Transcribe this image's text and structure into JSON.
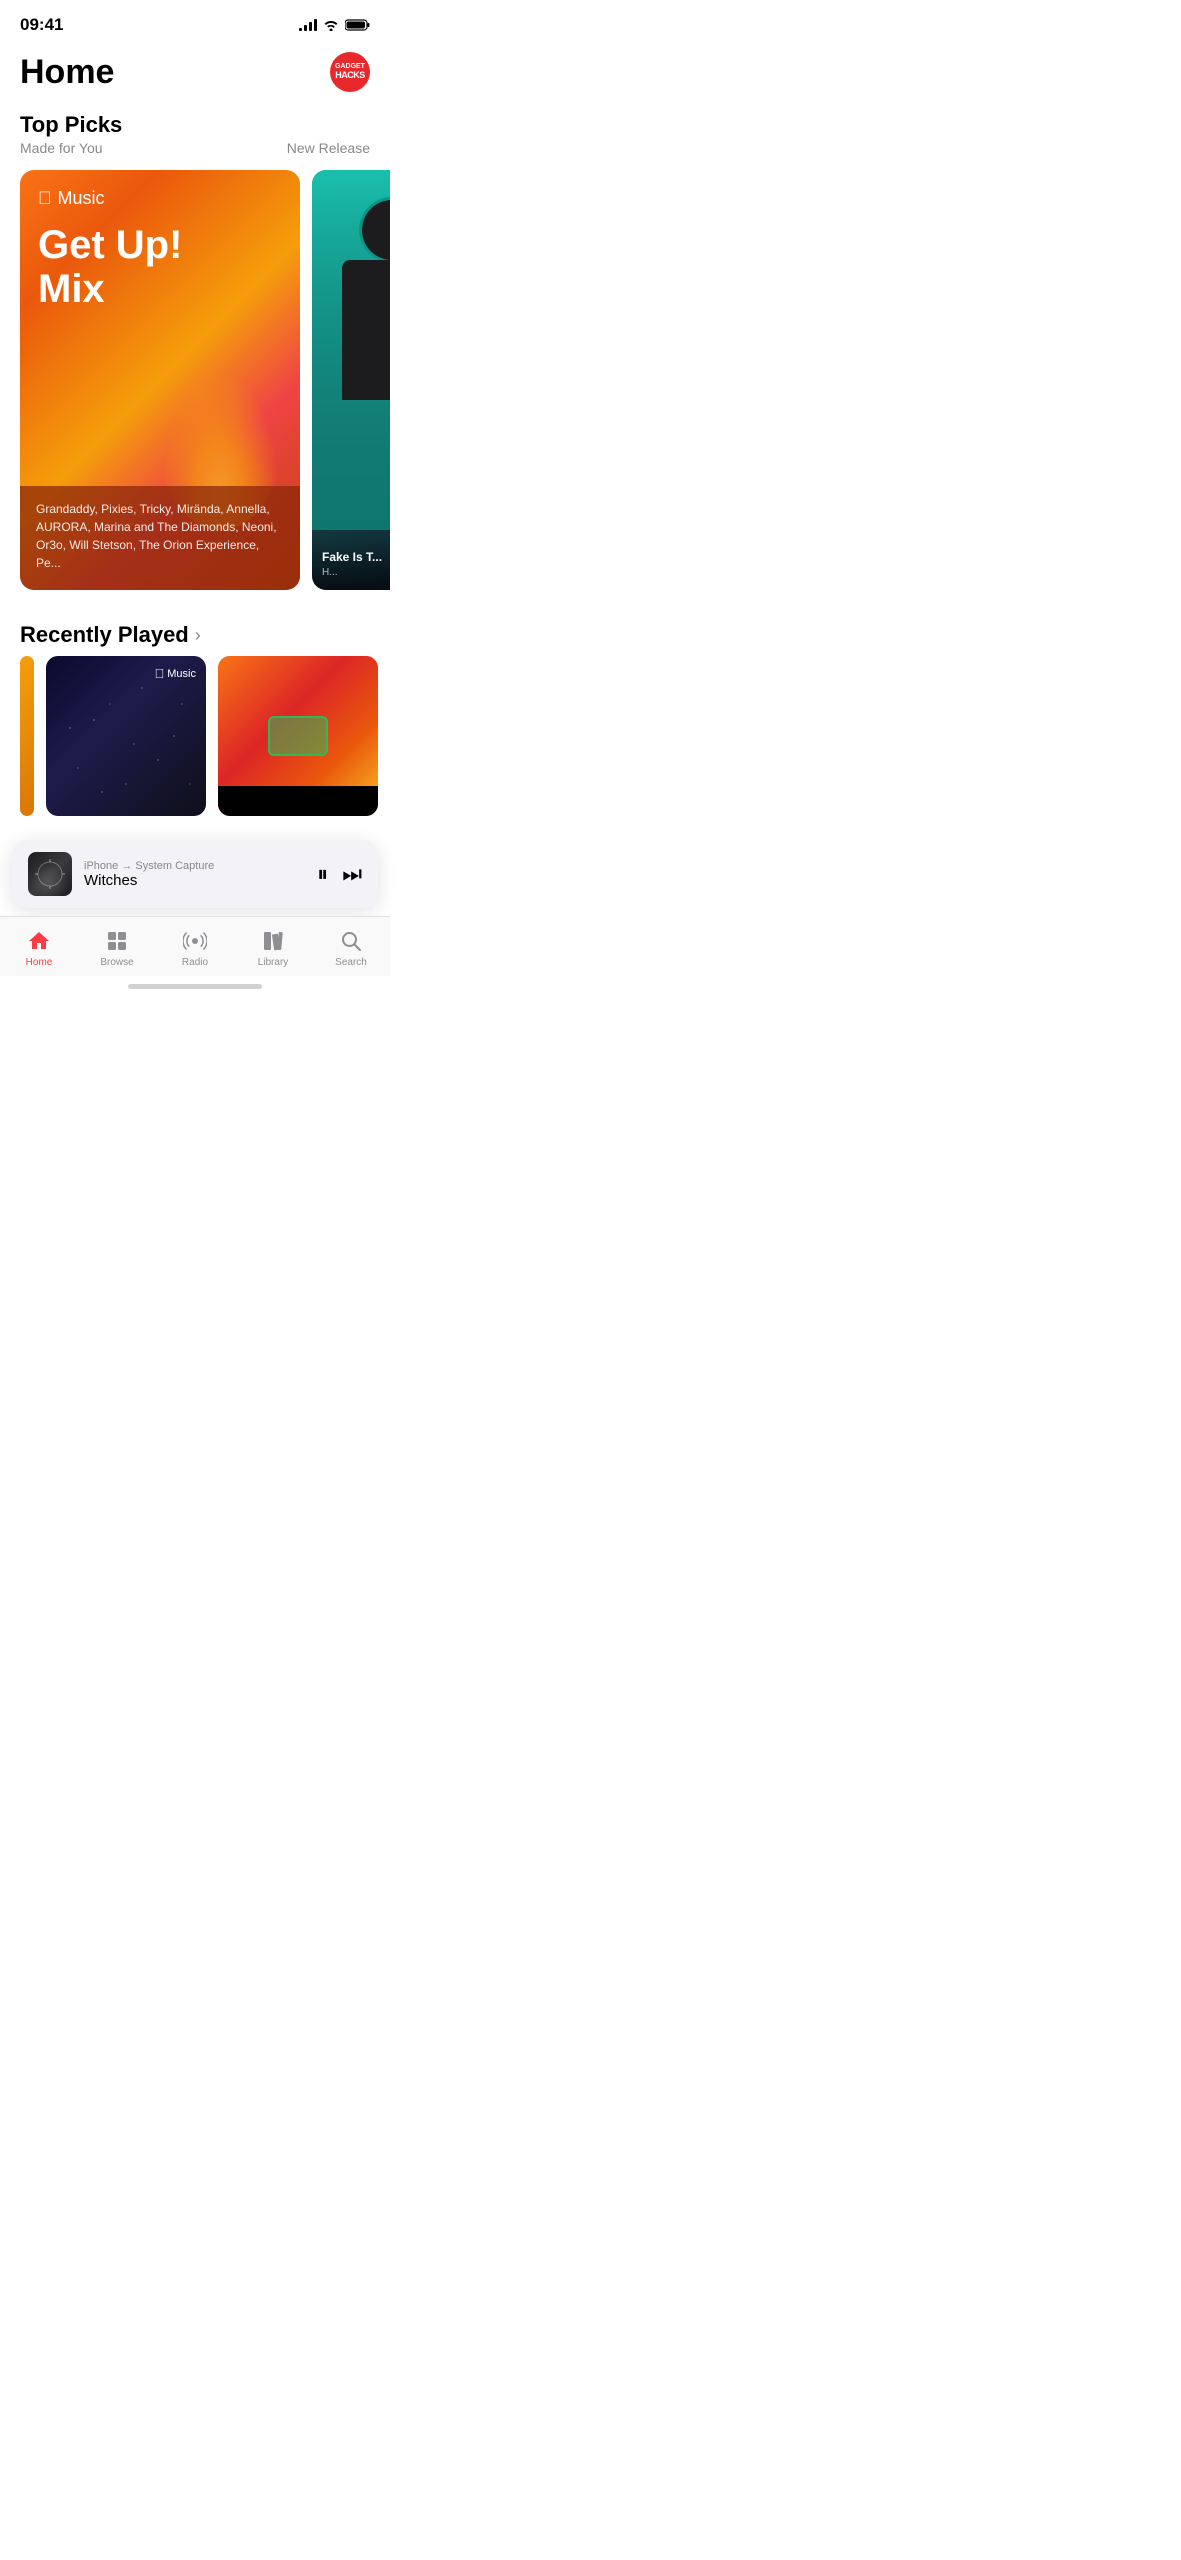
{
  "statusBar": {
    "time": "09:41",
    "signalBars": [
      3,
      6,
      9,
      12
    ],
    "battery": "100"
  },
  "header": {
    "title": "Home",
    "avatar": {
      "topText": "GADGET",
      "bottomText": "HACKS"
    }
  },
  "topPicks": {
    "sectionTitle": "Top Picks",
    "leftLabel": "Made for You",
    "rightLabel": "New Release",
    "featuredCard": {
      "appleMusicLabel": "Music",
      "title": "Get Up!",
      "subtitle": "Mix",
      "caption": "Grandaddy, Pixies, Tricky, Mirända, Annella, AURORA, Marina and The Diamonds, Neoni, Or3o, Will Stetson, The Orion Experience, Pe..."
    },
    "secondaryCard": {
      "caption": "Fake Is T..."
    }
  },
  "recentlyPlayed": {
    "sectionTitle": "Recently Played",
    "arrowLabel": "›",
    "cards": [
      {
        "type": "partial",
        "bg": "orange"
      },
      {
        "type": "stars",
        "appleMusicBadge": "Music"
      },
      {
        "type": "orange",
        "hasOverlay": true
      },
      {
        "type": "purple",
        "bg": "purple"
      }
    ]
  },
  "miniPlayer": {
    "source": "iPhone → System Capture",
    "title": "Witches",
    "pauseBtn": "⏸",
    "skipBtn": "⏭"
  },
  "tabBar": {
    "tabs": [
      {
        "id": "home",
        "label": "Home",
        "icon": "🏠",
        "active": true
      },
      {
        "id": "browse",
        "label": "Browse",
        "icon": "⊞",
        "active": false
      },
      {
        "id": "radio",
        "label": "Radio",
        "icon": "📡",
        "active": false
      },
      {
        "id": "library",
        "label": "Library",
        "icon": "📚",
        "active": false
      },
      {
        "id": "search",
        "label": "Search",
        "icon": "🔍",
        "active": false
      }
    ]
  }
}
